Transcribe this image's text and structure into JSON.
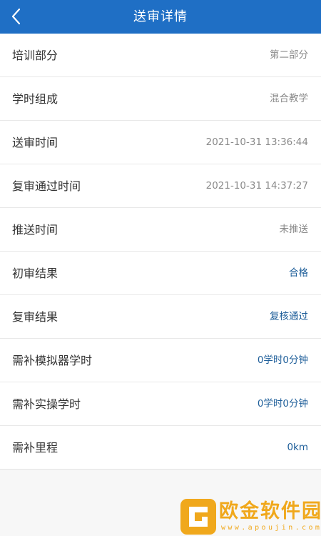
{
  "header": {
    "title": "送审详情",
    "back_icon": "chevron-left-icon",
    "background_color": "#1f6fc5"
  },
  "rows": [
    {
      "label": "培训部分",
      "value": "第二部分",
      "style": "muted"
    },
    {
      "label": "学时组成",
      "value": "混合教学",
      "style": "muted"
    },
    {
      "label": "送审时间",
      "value": "2021-10-31 13:36:44",
      "style": "muted"
    },
    {
      "label": "复审通过时间",
      "value": "2021-10-31 14:37:27",
      "style": "muted"
    },
    {
      "label": "推送时间",
      "value": "未推送",
      "style": "muted"
    },
    {
      "label": "初审结果",
      "value": "合格",
      "style": "accent"
    },
    {
      "label": "复审结果",
      "value": "复核通过",
      "style": "accent"
    },
    {
      "label": "需补模拟器学时",
      "value": "0学时0分钟",
      "style": "accent"
    },
    {
      "label": "需补实操学时",
      "value": "0学时0分钟",
      "style": "accent"
    },
    {
      "label": "需补里程",
      "value": "0km",
      "style": "accent"
    }
  ],
  "colors": {
    "muted_value": "#8a8a8a",
    "accent_value": "#1f5f9a",
    "watermark": "#f0a81c"
  },
  "watermark": {
    "logo_icon": "apoujin-logo-icon",
    "text": "欧金软件园",
    "url": "www.apoujin.com"
  }
}
